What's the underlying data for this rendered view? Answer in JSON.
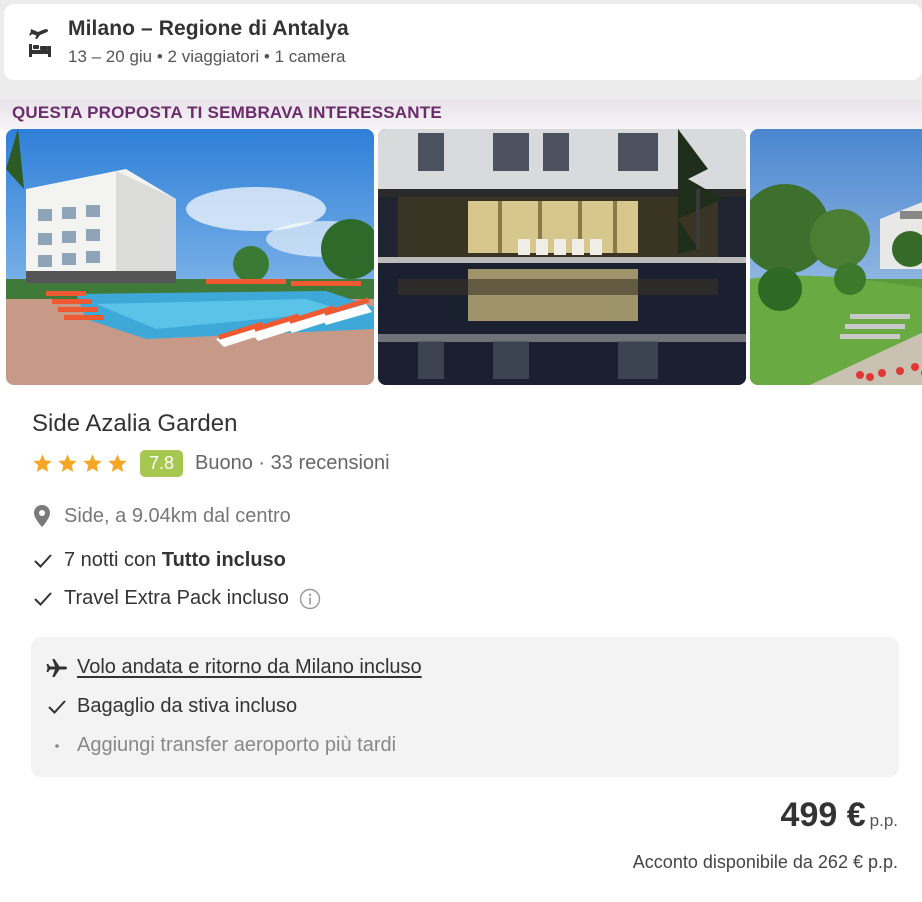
{
  "search": {
    "title": "Milano – Regione di Antalya",
    "details": "13 – 20 giu • 2 viaggiatori • 1 camera",
    "icon": "flight-hotel-icon"
  },
  "section": {
    "label": "QUESTA PROPOSTA TI SEMBRAVA INTERESSANTE"
  },
  "hotel": {
    "name": "Side Azalia Garden",
    "stars": 4,
    "score": "7.8",
    "rating_text": "Buono · 33 recensioni",
    "location": "Side, a 9.04km dal centro",
    "features": [
      {
        "prefix": "7 notti con ",
        "bold": "Tutto incluso"
      },
      {
        "text": "Travel Extra Pack incluso"
      }
    ]
  },
  "flight_box": {
    "flight_link": "Volo andata e ritorno da Milano incluso",
    "baggage": "Bagaglio da stiva incluso",
    "transfer": "Aggiungi transfer aeroporto più tardi"
  },
  "price": {
    "value": "499 €",
    "unit": "p.p.",
    "deposit": "Acconto disponibile da 262 € p.p."
  },
  "colors": {
    "accent_label": "#6a2c6b",
    "score_bg": "#a7c850",
    "star": "#f5a623"
  }
}
